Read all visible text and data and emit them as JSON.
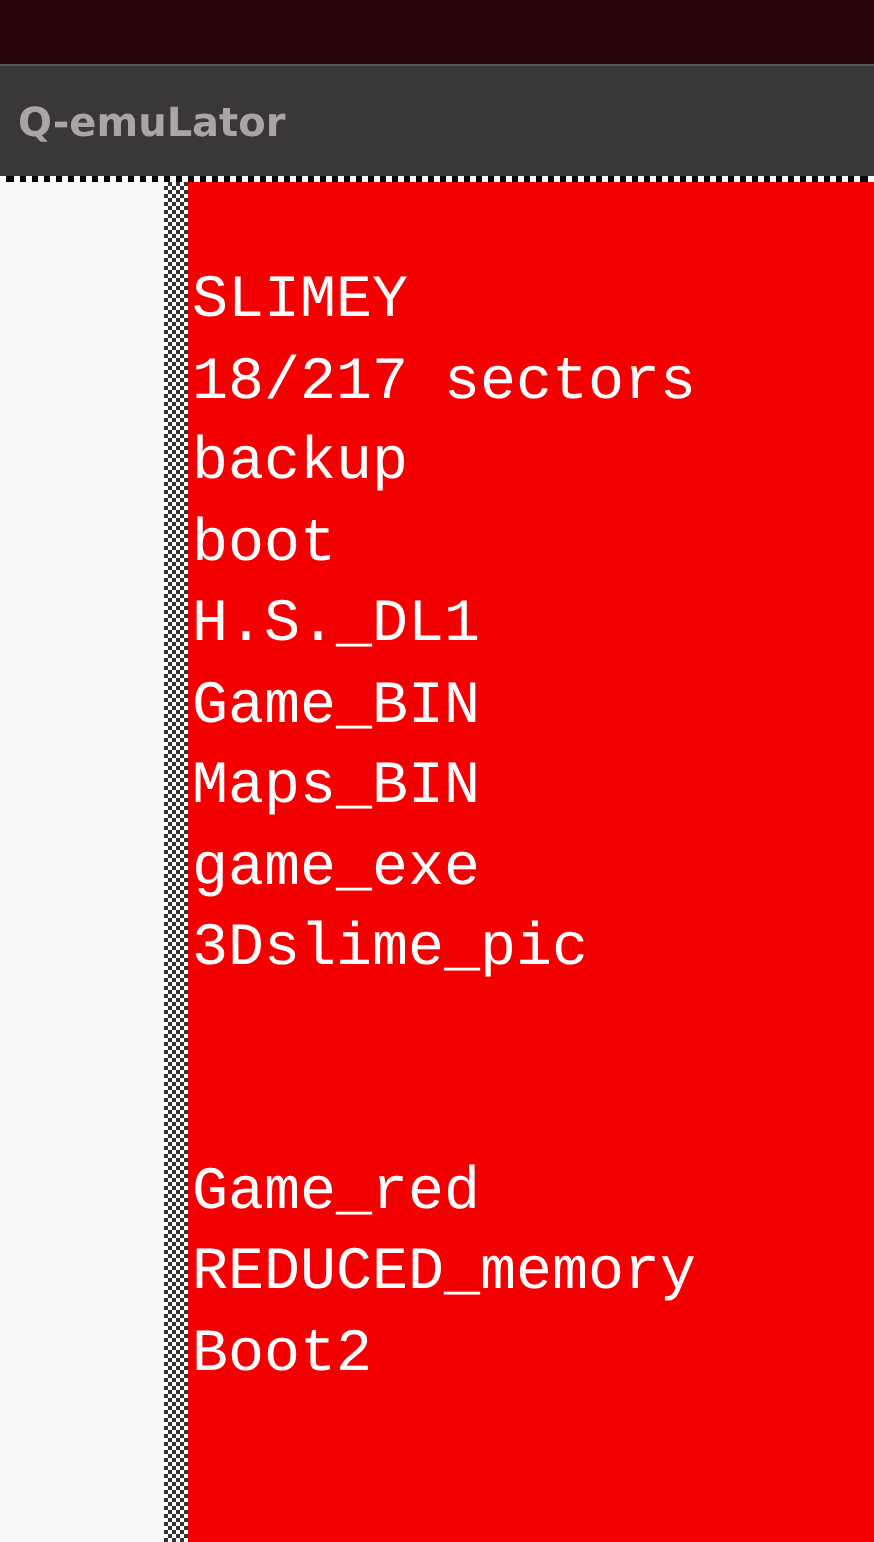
{
  "window": {
    "title": "Q-emuLator"
  },
  "screen": {
    "sections": [
      {
        "lines": [
          "SLIMEY",
          "18/217 sectors",
          "backup",
          "boot",
          "H.S._DL1",
          "Game_BIN",
          "Maps_BIN",
          "game_exe",
          "3Dslime_pic"
        ]
      },
      {
        "lines": [
          "Game_red",
          "REDUCED_memory",
          "Boot2"
        ]
      }
    ]
  }
}
